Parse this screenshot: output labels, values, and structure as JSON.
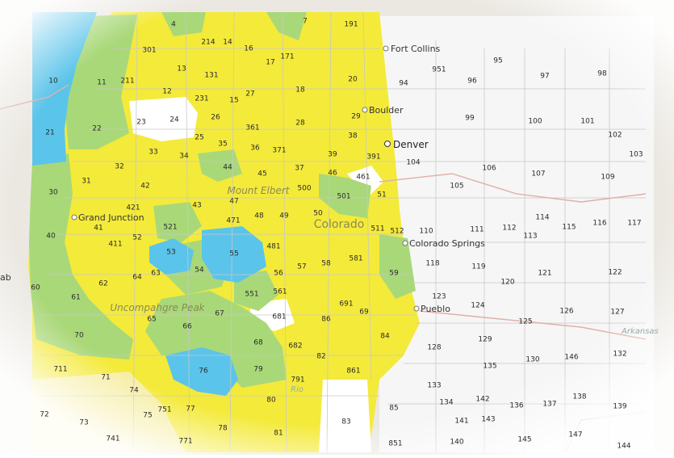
{
  "colors": {
    "yellow": "#f4ea3a",
    "green": "#a9d879",
    "blue": "#5bc4ea",
    "white": "#ffffff",
    "plains": "#f6f6f6",
    "terrain": "#ebe8e2",
    "road": "#e0a89c"
  },
  "regions": {
    "mount_elbert": "Mount Elbert",
    "colorado": "Colorado",
    "uncompahgre_peak": "Uncompahgre Peak",
    "river": "Rio",
    "arkansas": "Arkansas"
  },
  "cities": [
    {
      "id": "fort-collins",
      "label": "Fort Collins"
    },
    {
      "id": "boulder",
      "label": "Boulder"
    },
    {
      "id": "denver",
      "label": "Denver"
    },
    {
      "id": "grand-junction",
      "label": "Grand Junction"
    },
    {
      "id": "colorado-springs",
      "label": "Colorado Springs"
    },
    {
      "id": "pueblo",
      "label": "Pueblo"
    }
  ],
  "edge_labels": {
    "left_ab": "ab"
  },
  "units": [
    {
      "id": "u4",
      "label": "4",
      "c": "green"
    },
    {
      "id": "u214",
      "label": "214",
      "c": "yellow"
    },
    {
      "id": "u14",
      "label": "14",
      "c": "yellow"
    },
    {
      "id": "u7",
      "label": "7",
      "c": "yellow"
    },
    {
      "id": "u191",
      "label": "191",
      "c": "plains"
    },
    {
      "id": "u301",
      "label": "301",
      "c": "yellow"
    },
    {
      "id": "u16",
      "label": "16",
      "c": "yellow"
    },
    {
      "id": "u17",
      "label": "17",
      "c": "yellow"
    },
    {
      "id": "u171",
      "label": "171",
      "c": "yellow"
    },
    {
      "id": "u10",
      "label": "10",
      "c": "blue"
    },
    {
      "id": "u11",
      "label": "11",
      "c": "green"
    },
    {
      "id": "u211",
      "label": "211",
      "c": "yellow"
    },
    {
      "id": "u13",
      "label": "13",
      "c": "yellow"
    },
    {
      "id": "u131",
      "label": "131",
      "c": "yellow"
    },
    {
      "id": "u20",
      "label": "20",
      "c": "yellow"
    },
    {
      "id": "u12",
      "label": "12",
      "c": "yellow"
    },
    {
      "id": "u231",
      "label": "231",
      "c": "yellow"
    },
    {
      "id": "u15",
      "label": "15",
      "c": "yellow"
    },
    {
      "id": "u27",
      "label": "27",
      "c": "yellow"
    },
    {
      "id": "u18",
      "label": "18",
      "c": "yellow"
    },
    {
      "id": "u23",
      "label": "23",
      "c": "white"
    },
    {
      "id": "u24",
      "label": "24",
      "c": "white"
    },
    {
      "id": "u26",
      "label": "26",
      "c": "yellow"
    },
    {
      "id": "u361",
      "label": "361",
      "c": "yellow"
    },
    {
      "id": "u28",
      "label": "28",
      "c": "yellow"
    },
    {
      "id": "u29",
      "label": "29",
      "c": "yellow"
    },
    {
      "id": "u21",
      "label": "21",
      "c": "blue"
    },
    {
      "id": "u22",
      "label": "22",
      "c": "green"
    },
    {
      "id": "u25",
      "label": "25",
      "c": "yellow"
    },
    {
      "id": "u35",
      "label": "35",
      "c": "yellow"
    },
    {
      "id": "u36",
      "label": "36",
      "c": "yellow"
    },
    {
      "id": "u371",
      "label": "371",
      "c": "yellow"
    },
    {
      "id": "u38",
      "label": "38",
      "c": "yellow"
    },
    {
      "id": "u33",
      "label": "33",
      "c": "yellow"
    },
    {
      "id": "u34",
      "label": "34",
      "c": "yellow"
    },
    {
      "id": "u39",
      "label": "39",
      "c": "yellow"
    },
    {
      "id": "u391",
      "label": "391",
      "c": "yellow"
    },
    {
      "id": "u32",
      "label": "32",
      "c": "yellow"
    },
    {
      "id": "u44",
      "label": "44",
      "c": "green"
    },
    {
      "id": "u45",
      "label": "45",
      "c": "yellow"
    },
    {
      "id": "u37",
      "label": "37",
      "c": "yellow"
    },
    {
      "id": "u46",
      "label": "46",
      "c": "yellow"
    },
    {
      "id": "u461",
      "label": "461",
      "c": "white"
    },
    {
      "id": "u31",
      "label": "31",
      "c": "yellow"
    },
    {
      "id": "u42",
      "label": "42",
      "c": "yellow"
    },
    {
      "id": "u500",
      "label": "500",
      "c": "yellow"
    },
    {
      "id": "u501",
      "label": "501",
      "c": "green"
    },
    {
      "id": "u51",
      "label": "51",
      "c": "yellow"
    },
    {
      "id": "u30",
      "label": "30",
      "c": "green"
    },
    {
      "id": "u421",
      "label": "421",
      "c": "yellow"
    },
    {
      "id": "u43",
      "label": "43",
      "c": "yellow"
    },
    {
      "id": "u47",
      "label": "47",
      "c": "yellow"
    },
    {
      "id": "u48",
      "label": "48",
      "c": "yellow"
    },
    {
      "id": "u49",
      "label": "49",
      "c": "yellow"
    },
    {
      "id": "u50",
      "label": "50",
      "c": "yellow"
    },
    {
      "id": "u471",
      "label": "471",
      "c": "yellow"
    },
    {
      "id": "u41",
      "label": "41",
      "c": "yellow"
    },
    {
      "id": "u521",
      "label": "521",
      "c": "green"
    },
    {
      "id": "u511",
      "label": "511",
      "c": "yellow"
    },
    {
      "id": "u512",
      "label": "512",
      "c": "yellow"
    },
    {
      "id": "u40",
      "label": "40",
      "c": "green"
    },
    {
      "id": "u52",
      "label": "52",
      "c": "yellow"
    },
    {
      "id": "u411",
      "label": "411",
      "c": "yellow"
    },
    {
      "id": "u481",
      "label": "481",
      "c": "yellow"
    },
    {
      "id": "u53",
      "label": "53",
      "c": "blue"
    },
    {
      "id": "u55",
      "label": "55",
      "c": "blue"
    },
    {
      "id": "u581",
      "label": "581",
      "c": "yellow"
    },
    {
      "id": "u58",
      "label": "58",
      "c": "yellow"
    },
    {
      "id": "u57",
      "label": "57",
      "c": "yellow"
    },
    {
      "id": "u54",
      "label": "54",
      "c": "green"
    },
    {
      "id": "u56",
      "label": "56",
      "c": "yellow"
    },
    {
      "id": "u59",
      "label": "59",
      "c": "green"
    },
    {
      "id": "u64",
      "label": "64",
      "c": "yellow"
    },
    {
      "id": "u63",
      "label": "63",
      "c": "yellow"
    },
    {
      "id": "u62",
      "label": "62",
      "c": "yellow"
    },
    {
      "id": "u60",
      "label": "60",
      "c": "yellow"
    },
    {
      "id": "u551",
      "label": "551",
      "c": "green"
    },
    {
      "id": "u561",
      "label": "561",
      "c": "yellow"
    },
    {
      "id": "u61",
      "label": "61",
      "c": "green"
    },
    {
      "id": "u691",
      "label": "691",
      "c": "yellow"
    },
    {
      "id": "u69",
      "label": "69",
      "c": "yellow"
    },
    {
      "id": "u67",
      "label": "67",
      "c": "green"
    },
    {
      "id": "u65",
      "label": "65",
      "c": "yellow"
    },
    {
      "id": "u681",
      "label": "681",
      "c": "white"
    },
    {
      "id": "u66",
      "label": "66",
      "c": "green"
    },
    {
      "id": "u86",
      "label": "86",
      "c": "yellow"
    },
    {
      "id": "u70",
      "label": "70",
      "c": "green"
    },
    {
      "id": "u68",
      "label": "68",
      "c": "green"
    },
    {
      "id": "u84",
      "label": "84",
      "c": "yellow"
    },
    {
      "id": "u682",
      "label": "682",
      "c": "yellow"
    },
    {
      "id": "u82",
      "label": "82",
      "c": "yellow"
    },
    {
      "id": "u76",
      "label": "76",
      "c": "blue"
    },
    {
      "id": "u79",
      "label": "79",
      "c": "green"
    },
    {
      "id": "u711",
      "label": "711",
      "c": "yellow"
    },
    {
      "id": "u71",
      "label": "71",
      "c": "yellow"
    },
    {
      "id": "u861",
      "label": "861",
      "c": "yellow"
    },
    {
      "id": "u791",
      "label": "791",
      "c": "yellow"
    },
    {
      "id": "u74",
      "label": "74",
      "c": "yellow"
    },
    {
      "id": "u80",
      "label": "80",
      "c": "yellow"
    },
    {
      "id": "u751",
      "label": "751",
      "c": "yellow"
    },
    {
      "id": "u77",
      "label": "77",
      "c": "yellow"
    },
    {
      "id": "u75",
      "label": "75",
      "c": "yellow"
    },
    {
      "id": "u85",
      "label": "85",
      "c": "yellow"
    },
    {
      "id": "u72",
      "label": "72",
      "c": "yellow"
    },
    {
      "id": "u73",
      "label": "73",
      "c": "yellow"
    },
    {
      "id": "u83",
      "label": "83",
      "c": "white"
    },
    {
      "id": "u78",
      "label": "78",
      "c": "yellow"
    },
    {
      "id": "u81",
      "label": "81",
      "c": "yellow"
    },
    {
      "id": "u741",
      "label": "741",
      "c": "yellow"
    },
    {
      "id": "u771",
      "label": "771",
      "c": "yellow"
    },
    {
      "id": "u851",
      "label": "851",
      "c": "yellow"
    },
    {
      "id": "u951",
      "label": "951",
      "c": "plains"
    },
    {
      "id": "u95",
      "label": "95",
      "c": "plains"
    },
    {
      "id": "u94",
      "label": "94",
      "c": "plains"
    },
    {
      "id": "u96",
      "label": "96",
      "c": "plains"
    },
    {
      "id": "u97",
      "label": "97",
      "c": "plains"
    },
    {
      "id": "u98",
      "label": "98",
      "c": "plains"
    },
    {
      "id": "u99",
      "label": "99",
      "c": "plains"
    },
    {
      "id": "u100",
      "label": "100",
      "c": "plains"
    },
    {
      "id": "u101",
      "label": "101",
      "c": "plains"
    },
    {
      "id": "u102",
      "label": "102",
      "c": "plains"
    },
    {
      "id": "u103",
      "label": "103",
      "c": "plains"
    },
    {
      "id": "u104",
      "label": "104",
      "c": "plains"
    },
    {
      "id": "u106",
      "label": "106",
      "c": "plains"
    },
    {
      "id": "u107",
      "label": "107",
      "c": "plains"
    },
    {
      "id": "u105",
      "label": "105",
      "c": "plains"
    },
    {
      "id": "u109",
      "label": "109",
      "c": "plains"
    },
    {
      "id": "u114",
      "label": "114",
      "c": "plains"
    },
    {
      "id": "u110",
      "label": "110",
      "c": "plains"
    },
    {
      "id": "u111",
      "label": "111",
      "c": "plains"
    },
    {
      "id": "u112",
      "label": "112",
      "c": "plains"
    },
    {
      "id": "u113",
      "label": "113",
      "c": "plains"
    },
    {
      "id": "u115",
      "label": "115",
      "c": "plains"
    },
    {
      "id": "u116",
      "label": "116",
      "c": "plains"
    },
    {
      "id": "u117",
      "label": "117",
      "c": "plains"
    },
    {
      "id": "u118",
      "label": "118",
      "c": "plains"
    },
    {
      "id": "u119",
      "label": "119",
      "c": "plains"
    },
    {
      "id": "u121",
      "label": "121",
      "c": "plains"
    },
    {
      "id": "u122",
      "label": "122",
      "c": "plains"
    },
    {
      "id": "u120",
      "label": "120",
      "c": "plains"
    },
    {
      "id": "u123",
      "label": "123",
      "c": "plains"
    },
    {
      "id": "u124",
      "label": "124",
      "c": "plains"
    },
    {
      "id": "u126",
      "label": "126",
      "c": "plains"
    },
    {
      "id": "u127",
      "label": "127",
      "c": "plains"
    },
    {
      "id": "u125",
      "label": "125",
      "c": "plains"
    },
    {
      "id": "u128",
      "label": "128",
      "c": "plains"
    },
    {
      "id": "u129",
      "label": "129",
      "c": "plains"
    },
    {
      "id": "u130",
      "label": "130",
      "c": "plains"
    },
    {
      "id": "u146",
      "label": "146",
      "c": "plains"
    },
    {
      "id": "u132",
      "label": "132",
      "c": "plains"
    },
    {
      "id": "u135",
      "label": "135",
      "c": "plains"
    },
    {
      "id": "u133",
      "label": "133",
      "c": "plains"
    },
    {
      "id": "u134",
      "label": "134",
      "c": "plains"
    },
    {
      "id": "u142",
      "label": "142",
      "c": "plains"
    },
    {
      "id": "u136",
      "label": "136",
      "c": "plains"
    },
    {
      "id": "u137",
      "label": "137",
      "c": "plains"
    },
    {
      "id": "u138",
      "label": "138",
      "c": "plains"
    },
    {
      "id": "u139",
      "label": "139",
      "c": "plains"
    },
    {
      "id": "u141",
      "label": "141",
      "c": "plains"
    },
    {
      "id": "u143",
      "label": "143",
      "c": "plains"
    },
    {
      "id": "u140",
      "label": "140",
      "c": "plains"
    },
    {
      "id": "u145",
      "label": "145",
      "c": "plains"
    },
    {
      "id": "u147",
      "label": "147",
      "c": "plains"
    },
    {
      "id": "u144",
      "label": "144",
      "c": "plains"
    }
  ]
}
